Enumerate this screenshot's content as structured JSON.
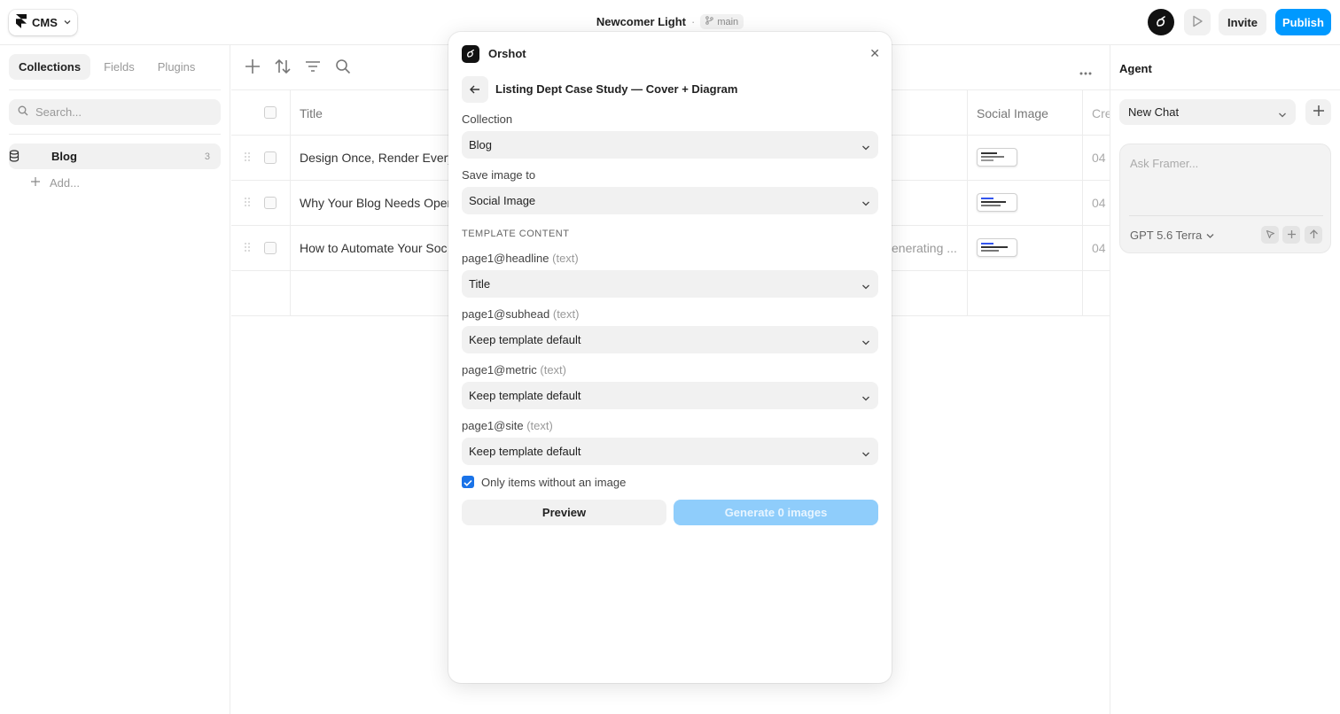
{
  "topbar": {
    "cms_label": "CMS",
    "doc_title": "Newcomer Light",
    "separator": "·",
    "branch": "main",
    "invite_label": "Invite",
    "publish_label": "Publish"
  },
  "sidebar": {
    "tabs": [
      {
        "label": "Collections",
        "active": true
      },
      {
        "label": "Fields",
        "active": false
      },
      {
        "label": "Plugins",
        "active": false
      }
    ],
    "search_placeholder": "Search...",
    "collections": [
      {
        "name": "Blog",
        "count": "3"
      }
    ],
    "add_label": "Add..."
  },
  "table": {
    "headers": {
      "title": "Title",
      "social_image": "Social Image",
      "created": "Cre"
    },
    "rows": [
      {
        "title": "Design Once, Render Every",
        "mid": "",
        "created": "04"
      },
      {
        "title": "Why Your Blog Needs Oper",
        "mid": "",
        "created": "04"
      },
      {
        "title": "How to Automate Your Soc",
        "mid": "enerating ...",
        "created": "04"
      }
    ]
  },
  "agent": {
    "title": "Agent",
    "new_chat": "New Chat",
    "ask_placeholder": "Ask Framer...",
    "model": "GPT 5.6 Terra"
  },
  "modal": {
    "app_name": "Orshot",
    "heading": "Listing Dept Case Study — Cover + Diagram",
    "collection_label": "Collection",
    "collection_value": "Blog",
    "save_label": "Save image to",
    "save_value": "Social Image",
    "section_title": "TEMPLATE CONTENT",
    "fields": [
      {
        "name": "page1@headline",
        "hint": "(text)",
        "value": "Title"
      },
      {
        "name": "page1@subhead",
        "hint": "(text)",
        "value": "Keep template default"
      },
      {
        "name": "page1@metric",
        "hint": "(text)",
        "value": "Keep template default"
      },
      {
        "name": "page1@site",
        "hint": "(text)",
        "value": "Keep template default"
      }
    ],
    "only_without_image_label": "Only items without an image",
    "only_without_image_checked": true,
    "preview_label": "Preview",
    "generate_label": "Generate 0 images"
  },
  "colors": {
    "accent": "#0099ff",
    "checkbox": "#1a73e8",
    "generate_disabled": "#8fcdfb"
  }
}
